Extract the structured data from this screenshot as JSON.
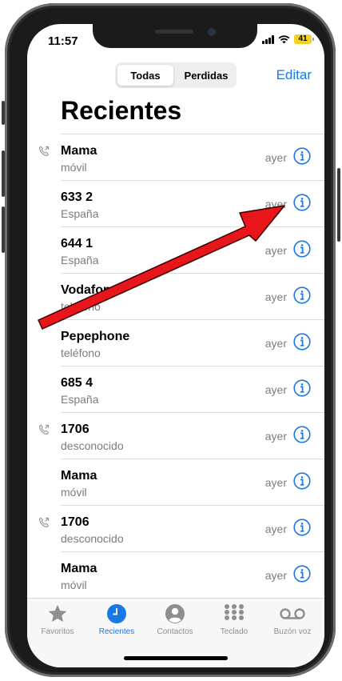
{
  "status": {
    "time": "11:57",
    "battery": "41"
  },
  "segment": {
    "tabs": [
      {
        "label": "Todas",
        "active": true
      },
      {
        "label": "Perdidas",
        "active": false
      }
    ]
  },
  "header": {
    "edit_label": "Editar",
    "title": "Recientes"
  },
  "calls": [
    {
      "name": "Mama",
      "type": "móvil",
      "time": "ayer",
      "outgoing": true
    },
    {
      "name": "633 2",
      "type": "España",
      "time": "ayer",
      "outgoing": false
    },
    {
      "name": "644 1",
      "type": "España",
      "time": "ayer",
      "outgoing": false
    },
    {
      "name": "Vodafone",
      "type": "teléfono",
      "time": "ayer",
      "outgoing": false
    },
    {
      "name": "Pepephone",
      "type": "teléfono",
      "time": "ayer",
      "outgoing": false
    },
    {
      "name": "685 4",
      "type": "España",
      "time": "ayer",
      "outgoing": false
    },
    {
      "name": "1706",
      "type": "desconocido",
      "time": "ayer",
      "outgoing": true
    },
    {
      "name": "Mama",
      "type": "móvil",
      "time": "ayer",
      "outgoing": false
    },
    {
      "name": "1706",
      "type": "desconocido",
      "time": "ayer",
      "outgoing": true
    },
    {
      "name": "Mama",
      "type": "móvil",
      "time": "ayer",
      "outgoing": false
    }
  ],
  "tabbar": [
    {
      "label": "Favoritos",
      "icon": "star-icon",
      "active": false
    },
    {
      "label": "Recientes",
      "icon": "clock-icon",
      "active": true
    },
    {
      "label": "Contactos",
      "icon": "person-icon",
      "active": false
    },
    {
      "label": "Teclado",
      "icon": "keypad-icon",
      "active": false
    },
    {
      "label": "Buzón voz",
      "icon": "voicemail-icon",
      "active": false
    }
  ],
  "colors": {
    "accent": "#1a78e6",
    "arrow": "#e8151b",
    "battery": "#f2d223"
  }
}
